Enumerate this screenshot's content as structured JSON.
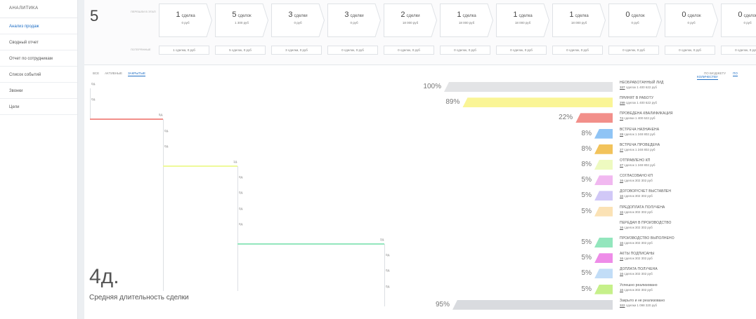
{
  "sidebar": {
    "title": "АНАЛИТИКА",
    "items": [
      {
        "label": "Анализ продаж",
        "active": true
      },
      {
        "label": "Сводный отчет",
        "active": false
      },
      {
        "label": "Отчет по сотрудникам",
        "active": false
      },
      {
        "label": "Список событий",
        "active": false
      },
      {
        "label": "Звонки",
        "active": false
      },
      {
        "label": "Цели",
        "active": false
      }
    ]
  },
  "stages": {
    "count": "5",
    "row_label_top": "ПЕРЕШЛИ В ЭТАП",
    "row_label_bottom": "ПОТЕРЯННЫЕ",
    "items": [
      {
        "num": "1",
        "unit": "сделка",
        "sum": "0 руб",
        "lost": "1 сделка, 0 руб"
      },
      {
        "num": "5",
        "unit": "сделок",
        "sum": "1 300 руб",
        "lost": "5 сделок, 0 руб"
      },
      {
        "num": "3",
        "unit": "сделки",
        "sum": "0 руб",
        "lost": "3 сделки, 0 руб"
      },
      {
        "num": "3",
        "unit": "сделки",
        "sum": "0 руб",
        "lost": "0 сделок, 0 руб"
      },
      {
        "num": "2",
        "unit": "сделки",
        "sum": "18 000 руб",
        "lost": "0 сделок, 0 руб"
      },
      {
        "num": "1",
        "unit": "сделка",
        "sum": "18 000 руб",
        "lost": "0 сделок, 0 руб"
      },
      {
        "num": "1",
        "unit": "сделка",
        "sum": "18 000 руб",
        "lost": "0 сделок, 0 руб"
      },
      {
        "num": "1",
        "unit": "сделка",
        "sum": "18 000 руб",
        "lost": "0 сделок, 0 руб"
      },
      {
        "num": "0",
        "unit": "сделок",
        "sum": "0 руб",
        "lost": "0 сделок, 0 руб"
      },
      {
        "num": "0",
        "unit": "сделок",
        "sum": "0 руб",
        "lost": "0 сделок, 0 руб"
      },
      {
        "num": "0",
        "unit": "сделок",
        "sum": "0 руб",
        "lost": "0 сделок, 0 руб"
      }
    ]
  },
  "tabs": {
    "left": [
      "ВСЕ",
      "АКТИВНЫЕ",
      "ЗАКРЫТЫЕ"
    ],
    "left_active": 2,
    "right": [
      "ПО БЮДЖЕТУ",
      "ПО КОЛИЧЕСТВУ"
    ],
    "right_active": 1
  },
  "funnel": [
    {
      "pct": "100%",
      "fraction": 1.0,
      "color": "#e3e4e6",
      "name": "НЕОБРАБОТАННЫЙ ЛИД",
      "count": "337",
      "info": "сделок 1 400 622 руб",
      "dur": "0д.",
      "line_color": ""
    },
    {
      "pct": "89%",
      "fraction": 0.89,
      "color": "#faf596",
      "name": "ПРИНЯТ В РАБОТУ",
      "count": "299",
      "info": "сделок 1 400 622 руб",
      "dur": "0д.",
      "line_color": ""
    },
    {
      "pct": "22%",
      "fraction": 0.22,
      "color": "#f28f8a",
      "name": "ПРОВЕДЕНА КВАЛИФИКАЦИЯ",
      "count": "74",
      "info": "сделки 1 400 622 руб",
      "dur": "5д.",
      "line_color": "#f28f8a"
    },
    {
      "pct": "8%",
      "fraction": 0.08,
      "color": "#8fc4f5",
      "name": "ВСТРЕЧА НАЗНАЧЕНА",
      "count": "28",
      "info": "сделок 1 248 802 руб",
      "dur": "0д.",
      "line_color": ""
    },
    {
      "pct": "8%",
      "fraction": 0.08,
      "color": "#f2c35b",
      "name": "ВСТРЕЧА ПРОВЕДЕНА",
      "count": "27",
      "info": "сделок 1 248 802 руб",
      "dur": "0д.",
      "line_color": ""
    },
    {
      "pct": "8%",
      "fraction": 0.08,
      "color": "#eefac0",
      "name": "ОТПРАВЛЕНО КП",
      "count": "27",
      "info": "сделок 1 248 802 руб",
      "dur": "1д.",
      "line_color": "#eefa9a"
    },
    {
      "pct": "5%",
      "fraction": 0.05,
      "color": "#f1b8f0",
      "name": "СОГЛАСОВАНО КП",
      "count": "16",
      "info": "сделок 302 302 руб",
      "dur": "0д.",
      "line_color": ""
    },
    {
      "pct": "5%",
      "fraction": 0.05,
      "color": "#d1c8f7",
      "name": "ДОГОВОР/СЧЕТ ВЫСТАВЛЕН",
      "count": "16",
      "info": "сделок 302 302 руб",
      "dur": "0д.",
      "line_color": ""
    },
    {
      "pct": "5%",
      "fraction": 0.05,
      "color": "#fbe2b5",
      "name": "ПРЕДОПЛАТА ПОЛУЧЕНА",
      "count": "16",
      "info": "сделок 302 302 руб",
      "dur": "0д.",
      "line_color": ""
    },
    {
      "pct": "",
      "fraction": 0.0,
      "color": "",
      "name": "ПЕРЕДАН В ПРОИЗВОДСТВО",
      "count": "16",
      "info": "сделок 302 302 руб",
      "dur": "0д.",
      "line_color": ""
    },
    {
      "pct": "5%",
      "fraction": 0.05,
      "color": "#93e6bd",
      "name": "ПРОИЗВОДСТВО ВЫПОЛНЕНО",
      "count": "16",
      "info": "сделок 302 302 руб",
      "dur": "2д.",
      "line_color": "#93e6bd"
    },
    {
      "pct": "5%",
      "fraction": 0.05,
      "color": "#ee8ce8",
      "name": "АКТЫ ПОДПИСАНЫ",
      "count": "16",
      "info": "сделок 302 302 руб",
      "dur": "0д.",
      "line_color": ""
    },
    {
      "pct": "5%",
      "fraction": 0.05,
      "color": "#c2ddf7",
      "name": "ДОПЛАТА ПОЛУЧЕНА",
      "count": "16",
      "info": "сделок 302 302 руб",
      "dur": "0д.",
      "line_color": ""
    },
    {
      "pct": "5%",
      "fraction": 0.05,
      "color": "#c6f08a",
      "name": "Успешно реализовано",
      "count": "16",
      "info": "сделок 302 302 руб",
      "dur": "0д.",
      "line_color": ""
    },
    {
      "pct": "95%",
      "fraction": 0.95,
      "color": "#d9dbdf",
      "name": "Закрыто и не реализовано",
      "count": "322",
      "info": "сделки 1 098 320 руб",
      "dur": "",
      "line_color": ""
    }
  ],
  "avg": {
    "value": "4д.",
    "label": "Средняя длительность сделки"
  }
}
